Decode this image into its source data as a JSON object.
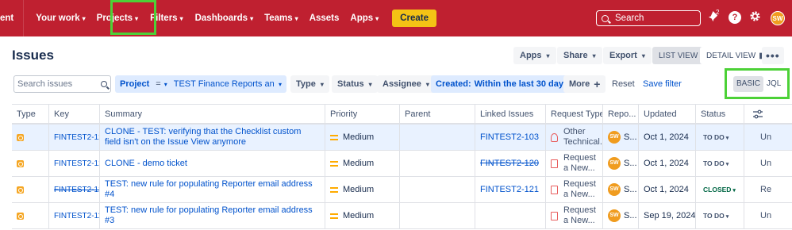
{
  "nav": {
    "left_fragment": "ent",
    "items": [
      {
        "label": "Your work",
        "chevron": true
      },
      {
        "label": "Projects",
        "chevron": true
      },
      {
        "label": "Filters",
        "chevron": true
      },
      {
        "label": "Dashboards",
        "chevron": true
      },
      {
        "label": "Teams",
        "chevron": true
      },
      {
        "label": "Assets",
        "chevron": false
      },
      {
        "label": "Apps",
        "chevron": true
      }
    ],
    "create_label": "Create",
    "search_placeholder": "Search",
    "notification_count": "2",
    "help_label": "?",
    "avatar_initials": "SW"
  },
  "header": {
    "title": "Issues",
    "apps_label": "Apps",
    "share_label": "Share",
    "export_label": "Export",
    "list_view_label": "LIST VIEW",
    "detail_view_label": "DETAIL VIEW",
    "more_label": "•••"
  },
  "filters": {
    "search_placeholder": "Search issues",
    "project_label": "Project",
    "project_operator": "=",
    "project_value": "TEST Finance Reports and S...",
    "type_label": "Type",
    "status_label": "Status",
    "assignee_label": "Assignee",
    "created_label": "Created:",
    "created_value": "Within the last 30 days",
    "clear_label": "✕",
    "more_label": "More",
    "more_icon": "+",
    "reset_label": "Reset",
    "save_filter_label": "Save filter",
    "basic_label": "BASIC",
    "jql_label": "JQL"
  },
  "table": {
    "columns": [
      "Type",
      "Key",
      "Summary",
      "Priority",
      "Parent",
      "Linked Issues",
      "Request Type",
      "Repo...",
      "Updated",
      "Status"
    ],
    "rows": [
      {
        "key": "FINTEST2-122",
        "key_strike": false,
        "summary": "CLONE - TEST: verifying that the Checklist custom field isn't on the Issue View anymore",
        "priority": "Medium",
        "parent": "",
        "linked": "FINTEST2-103",
        "linked_strike": false,
        "request_type": "Other Technical...",
        "request_icon": "headset-icon",
        "reporter_initials": "SW",
        "reporter": "S...",
        "updated": "Oct 1, 2024",
        "status": "TO DO",
        "status_color": "#42526e",
        "extra": "Un"
      },
      {
        "key": "FINTEST2-121",
        "key_strike": false,
        "summary": "CLONE - demo ticket",
        "priority": "Medium",
        "parent": "",
        "linked": "FINTEST2-120",
        "linked_strike": true,
        "request_type": "Request a New...",
        "request_icon": "document-icon",
        "reporter_initials": "SW",
        "reporter": "S...",
        "updated": "Oct 1, 2024",
        "status": "TO DO",
        "status_color": "#42526e",
        "extra": "Un"
      },
      {
        "key": "FINTEST2-120",
        "key_strike": true,
        "summary": "TEST: new rule for populating Reporter email address #4",
        "priority": "Medium",
        "parent": "",
        "linked": "FINTEST2-121",
        "linked_strike": false,
        "request_type": "Request a New...",
        "request_icon": "document-icon",
        "reporter_initials": "SW",
        "reporter": "S...",
        "updated": "Oct 1, 2024",
        "status": "CLOSED",
        "status_color": "#006644",
        "extra": "Re"
      },
      {
        "key": "FINTEST2-119",
        "key_strike": false,
        "summary": "TEST: new rule for populating Reporter email address #3",
        "priority": "Medium",
        "parent": "",
        "linked": "",
        "linked_strike": false,
        "request_type": "Request a New...",
        "request_icon": "document-icon",
        "reporter_initials": "SW",
        "reporter": "S...",
        "updated": "Sep 19, 2024",
        "status": "TO DO",
        "status_color": "#42526e",
        "extra": "Un"
      }
    ]
  },
  "colors": {
    "nav_bg": "#bf2030",
    "create_bg": "#f4c315",
    "highlight_box": "#4cd137",
    "link": "#0052cc",
    "selected_row": "#e9f2ff",
    "priority_medium": "#ffab00",
    "avatar": "#f09c1f"
  }
}
